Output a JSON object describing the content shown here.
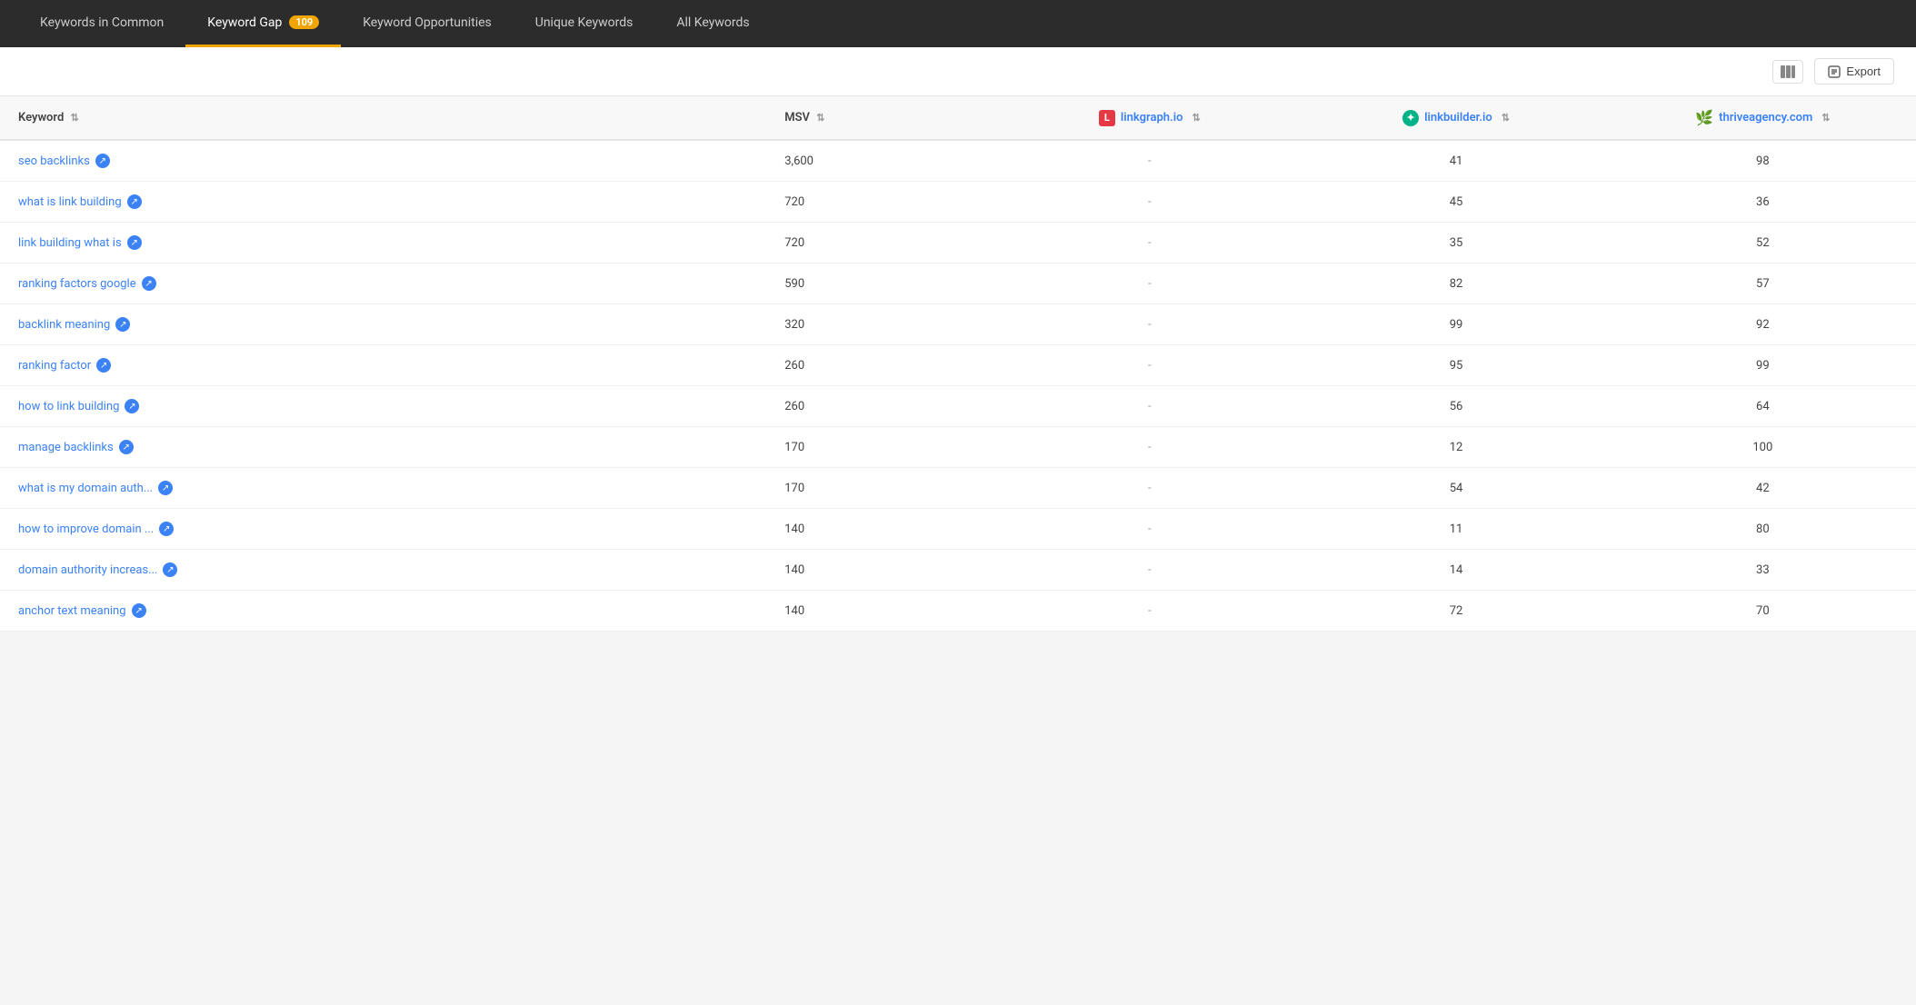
{
  "nav": {
    "tabs": [
      {
        "id": "keywords-in-common",
        "label": "Keywords in Common",
        "badge": null,
        "active": false
      },
      {
        "id": "keyword-gap",
        "label": "Keyword Gap",
        "badge": "109",
        "active": true
      },
      {
        "id": "keyword-opportunities",
        "label": "Keyword Opportunities",
        "badge": null,
        "active": false
      },
      {
        "id": "unique-keywords",
        "label": "Unique Keywords",
        "badge": null,
        "active": false
      },
      {
        "id": "all-keywords",
        "label": "All Keywords",
        "badge": null,
        "active": false
      }
    ]
  },
  "toolbar": {
    "export_label": "Export"
  },
  "table": {
    "columns": [
      {
        "id": "keyword",
        "label": "Keyword",
        "sortable": true
      },
      {
        "id": "msv",
        "label": "MSV",
        "sortable": true
      },
      {
        "id": "linkgraph",
        "label": "linkgraph.io",
        "sortable": true
      },
      {
        "id": "linkbuilder",
        "label": "linkbuilder.io",
        "sortable": true
      },
      {
        "id": "thrive",
        "label": "thriveagency.com",
        "sortable": true
      }
    ],
    "rows": [
      {
        "keyword": "seo backlinks",
        "msv": "3,600",
        "linkgraph": "-",
        "linkbuilder": "41",
        "thrive": "98"
      },
      {
        "keyword": "what is link building",
        "msv": "720",
        "linkgraph": "-",
        "linkbuilder": "45",
        "thrive": "36"
      },
      {
        "keyword": "link building what is",
        "msv": "720",
        "linkgraph": "-",
        "linkbuilder": "35",
        "thrive": "52"
      },
      {
        "keyword": "ranking factors google",
        "msv": "590",
        "linkgraph": "-",
        "linkbuilder": "82",
        "thrive": "57"
      },
      {
        "keyword": "backlink meaning",
        "msv": "320",
        "linkgraph": "-",
        "linkbuilder": "99",
        "thrive": "92"
      },
      {
        "keyword": "ranking factor",
        "msv": "260",
        "linkgraph": "-",
        "linkbuilder": "95",
        "thrive": "99"
      },
      {
        "keyword": "how to link building",
        "msv": "260",
        "linkgraph": "-",
        "linkbuilder": "56",
        "thrive": "64"
      },
      {
        "keyword": "manage backlinks",
        "msv": "170",
        "linkgraph": "-",
        "linkbuilder": "12",
        "thrive": "100"
      },
      {
        "keyword": "what is my domain auth...",
        "msv": "170",
        "linkgraph": "-",
        "linkbuilder": "54",
        "thrive": "42"
      },
      {
        "keyword": "how to improve domain ...",
        "msv": "140",
        "linkgraph": "-",
        "linkbuilder": "11",
        "thrive": "80"
      },
      {
        "keyword": "domain authority increas...",
        "msv": "140",
        "linkgraph": "-",
        "linkbuilder": "14",
        "thrive": "33"
      },
      {
        "keyword": "anchor text meaning",
        "msv": "140",
        "linkgraph": "-",
        "linkbuilder": "72",
        "thrive": "70"
      }
    ]
  }
}
